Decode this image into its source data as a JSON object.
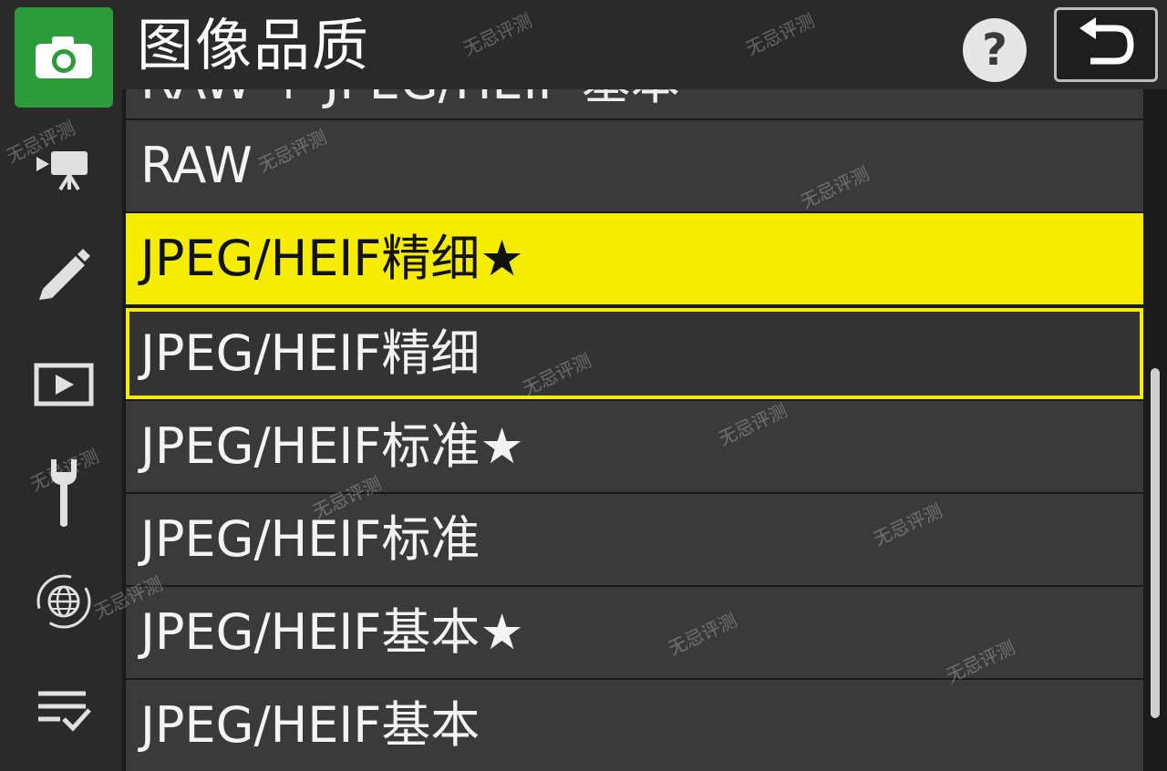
{
  "header": {
    "title": "图像品质",
    "help_label": "?"
  },
  "sidebar": {
    "items": [
      {
        "icon": "camera-icon",
        "active": true
      },
      {
        "icon": "movie-camera-icon",
        "active": false
      },
      {
        "icon": "pencil-icon",
        "active": false
      },
      {
        "icon": "playback-icon",
        "active": false
      },
      {
        "icon": "wrench-icon",
        "active": false
      },
      {
        "icon": "network-globe-icon",
        "active": false
      },
      {
        "icon": "my-menu-icon",
        "active": false
      }
    ]
  },
  "menu": {
    "partial_item": "RAW + JPEG/HEIF 基本",
    "items": [
      {
        "label": "RAW",
        "state": "normal"
      },
      {
        "label": "JPEG/HEIF精细★",
        "state": "highlighted"
      },
      {
        "label": "JPEG/HEIF精细",
        "state": "selected"
      },
      {
        "label": "JPEG/HEIF标准★",
        "state": "normal"
      },
      {
        "label": "JPEG/HEIF标准",
        "state": "normal"
      },
      {
        "label": "JPEG/HEIF基本★",
        "state": "normal"
      },
      {
        "label": "JPEG/HEIF基本",
        "state": "normal"
      }
    ]
  },
  "watermark": "无忌评测",
  "colors": {
    "accent_green": "#2e9b3a",
    "highlight_yellow": "#f5ec00",
    "row_bg": "#3a3a3a",
    "background": "#1a1a1a"
  }
}
